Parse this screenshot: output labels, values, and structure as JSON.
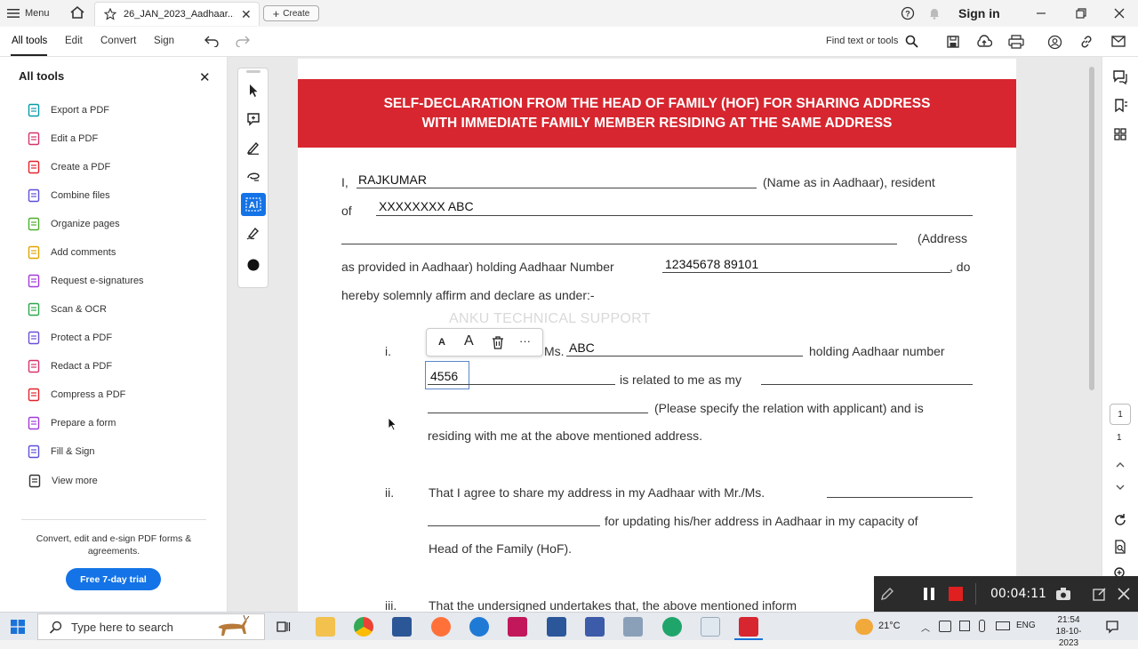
{
  "titlebar": {
    "menu_label": "Menu",
    "tab_title": "26_JAN_2023_Aadhaar...",
    "create_label": "Create",
    "sign_in_label": "Sign in"
  },
  "toolbar": {
    "menus": [
      "All tools",
      "Edit",
      "Convert",
      "Sign"
    ],
    "find_label": "Find text or tools"
  },
  "left_panel": {
    "title": "All tools",
    "tools": [
      {
        "label": "Export a PDF",
        "icon": "export-pdf-icon",
        "color": "#0b9aa8"
      },
      {
        "label": "Edit a PDF",
        "icon": "edit-pdf-icon",
        "color": "#d6336c"
      },
      {
        "label": "Create a PDF",
        "icon": "create-pdf-icon",
        "color": "#e0242b"
      },
      {
        "label": "Combine files",
        "icon": "combine-files-icon",
        "color": "#5d4fd8"
      },
      {
        "label": "Organize pages",
        "icon": "organize-pages-icon",
        "color": "#4caf2a"
      },
      {
        "label": "Add comments",
        "icon": "add-comments-icon",
        "color": "#e3a400"
      },
      {
        "label": "Request e-signatures",
        "icon": "request-esignatures-icon",
        "color": "#a33ad9"
      },
      {
        "label": "Scan & OCR",
        "icon": "scan-ocr-icon",
        "color": "#2aa84a"
      },
      {
        "label": "Protect a PDF",
        "icon": "protect-pdf-icon",
        "color": "#6b4fd8"
      },
      {
        "label": "Redact a PDF",
        "icon": "redact-pdf-icon",
        "color": "#d6336c"
      },
      {
        "label": "Compress a PDF",
        "icon": "compress-pdf-icon",
        "color": "#e0242b"
      },
      {
        "label": "Prepare a form",
        "icon": "prepare-form-icon",
        "color": "#a33ad9"
      },
      {
        "label": "Fill & Sign",
        "icon": "fill-sign-icon",
        "color": "#5d4fd8"
      },
      {
        "label": "View more",
        "icon": "view-more-icon",
        "color": "#333333"
      }
    ],
    "promo": "Convert, edit and e-sign PDF forms & agreements.",
    "trial_label": "Free 7-day trial"
  },
  "document": {
    "banner_line1": "SELF-DECLARATION FROM THE HEAD OF FAMILY (HOF) FOR SHARING ADDRESS",
    "banner_line2": "WITH IMMEDIATE FAMILY MEMBER  RESIDING AT THE SAME ADDRESS",
    "i_prefix": "I,",
    "name_value": "RAJKUMAR",
    "name_suffix": "(Name as in Aadhaar), resident",
    "of_label": "of",
    "address_value": "XXXXXXXX ABC",
    "address_suffix": "(Address",
    "holding_text": "as provided in Aadhaar) holding Aadhaar Number",
    "aadhaar_value": "12345678 89101",
    "do_text": ", do",
    "affirm_text": "hereby solemnly affirm and declare as under:-",
    "watermark": "ANKU TECHNICAL SUPPORT",
    "item1_num": "i.",
    "item1_ms": "Ms.",
    "member_name": "ABC",
    "item1_holding": "holding Aadhaar number",
    "member_aadhaar": "4556",
    "item1_related": "is related to me as my",
    "item1_specify": "(Please specify the relation with applicant) and is",
    "item1_residing": "residing with me at the above mentioned address.",
    "item2_num": "ii.",
    "item2_line1": "That I agree to share my address in my Aadhaar with Mr./Ms.",
    "item2_line2": "for updating his/her address in Aadhaar in my capacity of",
    "item2_line3": "Head of the Family (HoF).",
    "item3_num": "iii.",
    "item3_line1": "That the undersigned undertakes that, the above mentioned inform"
  },
  "right_rail": {
    "page_current": "1",
    "page_total": "1"
  },
  "recorder": {
    "time": "00:04:11"
  },
  "taskbar": {
    "search_placeholder": "Type here to search",
    "temperature": "21°C",
    "language": "ENG",
    "time": "21:54",
    "date": "18-10-2023"
  }
}
